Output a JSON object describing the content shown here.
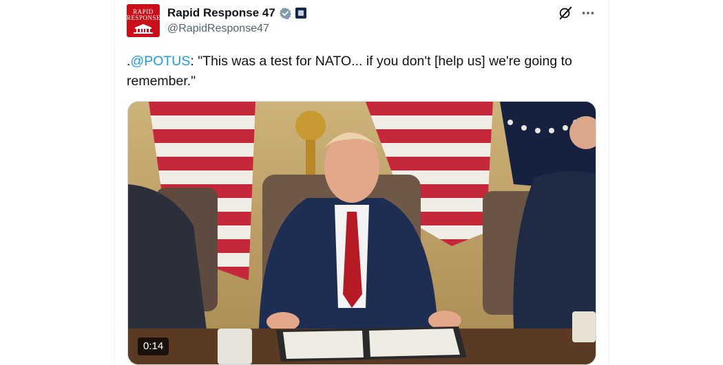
{
  "account": {
    "avatar_text_line1": "RAPID",
    "avatar_text_line2": "RESPONSE",
    "display_name": "Rapid Response 47",
    "handle": "@RapidResponse47"
  },
  "tweet": {
    "text_prefix": ".",
    "mention": "@POTUS",
    "text_body": ": \"This was a test for NATO... if you don't [help us] we're going to remember.\""
  },
  "media": {
    "type": "video",
    "duration": "0:14"
  },
  "icons": {
    "verified": "verified-badge-icon",
    "affiliation": "government-affiliation-icon",
    "grok": "grok-icon",
    "more": "more-options-icon"
  },
  "colors": {
    "mention": "#1d9bf0",
    "verified_badge": "#829aab",
    "avatar_bg": "#c9101a",
    "secondary_text": "#536471"
  }
}
